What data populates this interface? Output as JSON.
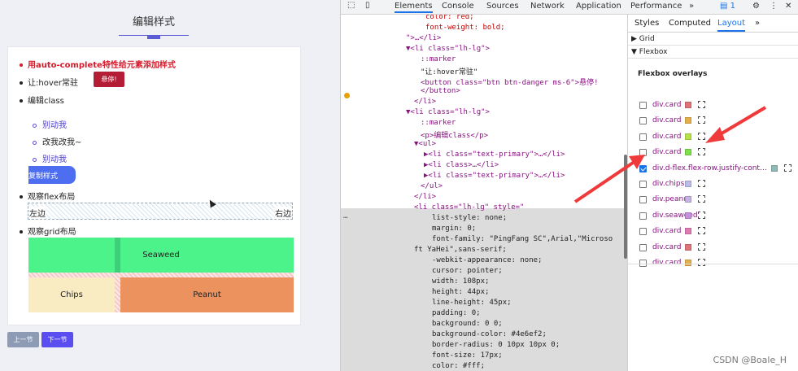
{
  "page": {
    "title": "编辑样式",
    "items": [
      {
        "label": "用auto-complete特性给元素添加样式"
      },
      {
        "label": "让:hover常驻",
        "button": "悬停!"
      },
      {
        "label": "编辑class"
      },
      {
        "label": "观察flex布局"
      },
      {
        "label": "观察grid布局"
      }
    ],
    "sub_items": [
      "别动我",
      "改我改我~",
      "别动我"
    ],
    "copy_button": "复制样式",
    "flex": {
      "left": "左边",
      "right": "右边"
    },
    "grid": {
      "seaweed": "Seaweed",
      "chips": "Chips",
      "peanut": "Peanut"
    },
    "nav": {
      "prev": "上一节",
      "next": "下一节"
    }
  },
  "devtools": {
    "tabs": [
      "Elements",
      "Console",
      "Sources",
      "Network",
      "Application",
      "Performance",
      "»"
    ],
    "badge": "1",
    "code_lines": [
      "color: red;",
      "font-weight: bold;",
      "\">…</li>",
      "▼<li class=\"lh-lg\">",
      "::marker",
      "\"让:hover常驻\"",
      "<button class=\"btn btn-danger ms-6\">悬停!",
      "</button>",
      "</li>",
      "▼<li class=\"lh-lg\">",
      "::marker",
      "<p>编辑class</p>",
      "▼<ul>",
      "▶<li class=\"text-primary\">…</li>",
      "▶<li class>…</li>",
      "▶<li class=\"text-primary\">…</li>",
      "</ul>",
      "</li>",
      "<li class=\"lh-lg\" style=\"",
      "list-style: none;",
      "margin: 0;",
      "font-family: \"PingFang SC\",Arial,\"Microso",
      "ft YaHei\",sans-serif;",
      "-webkit-appearance: none;",
      "cursor: pointer;",
      "width: 108px;",
      "height: 44px;",
      "line-height: 45px;",
      "padding: 0;",
      "background: 0 0;",
      "background-color: #4e6ef2;",
      "border-radius: 0 10px 10px 0;",
      "font-size: 17px;",
      "color: #fff;"
    ],
    "ellipsis": "…",
    "side_tabs": [
      "Styles",
      "Computed",
      "Layout",
      "»"
    ],
    "sections": [
      "Grid",
      "Flexbox"
    ],
    "overlays_title": "Flexbox overlays",
    "overlays": [
      {
        "label": "div.card",
        "color": "#e0737a",
        "checked": false
      },
      {
        "label": "div.card",
        "color": "#e4b04a",
        "checked": false
      },
      {
        "label": "div.card",
        "color": "#b7e04a",
        "checked": false
      },
      {
        "label": "div.card",
        "color": "#7ee04a",
        "checked": false
      },
      {
        "label": "div.d-flex.flex-row.justify-cont…",
        "color": "#8fb9b3",
        "checked": true
      },
      {
        "label": "div.chips",
        "color": "#b9bde8",
        "checked": false
      },
      {
        "label": "div.peanut",
        "color": "#c5b3e8",
        "checked": false
      },
      {
        "label": "div.seaweed",
        "color": "#c78fe0",
        "checked": false
      },
      {
        "label": "div.card",
        "color": "#e07ab3",
        "checked": false
      },
      {
        "label": "div.card",
        "color": "#e0737a",
        "checked": false
      },
      {
        "label": "div.card",
        "color": "#e4b04a",
        "checked": false
      }
    ],
    "watermark": "CSDN @Boale_H"
  },
  "colors": {
    "accent": "#4e6ef2",
    "danger": "#b31d35",
    "seaweed": "#4cf28a",
    "chips": "#f9ebc2",
    "peanut": "#ec925e",
    "arrow": "#f0393a"
  }
}
